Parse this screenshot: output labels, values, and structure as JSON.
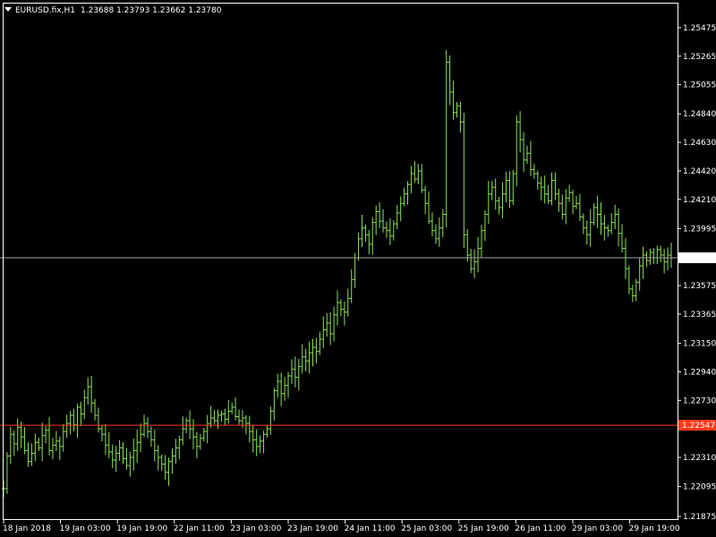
{
  "header": {
    "symbol": "EURUSD.fix,H1",
    "ohlc": "1.23688 1.23793 1.23662 1.23780"
  },
  "colors": {
    "background": "#000000",
    "bar": "#8be05a",
    "axis": "#ffffff",
    "bid_line": "#9fa6a8",
    "bid_label_bg": "#ffffff",
    "bid_label_text": "#000000",
    "alert_line": "#ff3b1a",
    "alert_label_bg": "#ff3b1a",
    "alert_label_text": "#000000"
  },
  "chart_data": {
    "type": "ohlc",
    "title": "",
    "ylim": [
      1.21875,
      1.2558
    ],
    "y_ticks": [
      "1.25475",
      "1.25265",
      "1.25055",
      "1.24840",
      "1.24630",
      "1.24420",
      "1.24210",
      "1.23995",
      "1.23780",
      "1.23575",
      "1.23365",
      "1.23150",
      "1.22940",
      "1.22730",
      "1.22547",
      "1.22310",
      "1.22095",
      "1.21875"
    ],
    "x_ticks": [
      "18 Jan 2018",
      "19 Jan 03:00",
      "19 Jan 19:00",
      "22 Jan 11:00",
      "23 Jan 03:00",
      "23 Jan 19:00",
      "24 Jan 11:00",
      "25 Jan 03:00",
      "25 Jan 19:00",
      "26 Jan 11:00",
      "29 Jan 03:00",
      "29 Jan 19:00"
    ],
    "current_price": "1.23780",
    "alert_level": "1.22547",
    "closes": [
      1.2208,
      1.2232,
      1.2248,
      1.2241,
      1.2253,
      1.2246,
      1.2236,
      1.2228,
      1.2234,
      1.2242,
      1.2238,
      1.2247,
      1.2251,
      1.2236,
      1.224,
      1.2243,
      1.2239,
      1.225,
      1.2256,
      1.2262,
      1.2255,
      1.2268,
      1.2263,
      1.2275,
      1.2283,
      1.2271,
      1.2262,
      1.2252,
      1.2248,
      1.224,
      1.2235,
      1.2229,
      1.2234,
      1.2238,
      1.223,
      1.2225,
      1.2231,
      1.2236,
      1.2242,
      1.2248,
      1.2256,
      1.225,
      1.2244,
      1.2236,
      1.2231,
      1.2226,
      1.222,
      1.2228,
      1.2232,
      1.2238,
      1.2244,
      1.2252,
      1.2258,
      1.2252,
      1.2246,
      1.2239,
      1.2245,
      1.225,
      1.2256,
      1.226,
      1.2258,
      1.2262,
      1.2263,
      1.2259,
      1.2265,
      1.2268,
      1.2261,
      1.2258,
      1.226,
      1.2256,
      1.225,
      1.2244,
      1.2239,
      1.2243,
      1.2248,
      1.2252,
      1.2265,
      1.228,
      1.2287,
      1.2278,
      1.2284,
      1.2291,
      1.2296,
      1.229,
      1.2298,
      1.2305,
      1.2302,
      1.2308,
      1.2312,
      1.2309,
      1.2318,
      1.2325,
      1.233,
      1.2322,
      1.2336,
      1.2345,
      1.234,
      1.2338,
      1.2348,
      1.2362,
      1.2378,
      1.2392,
      1.24,
      1.2395,
      1.2388,
      1.2404,
      1.2412,
      1.2405,
      1.24,
      1.2398,
      1.2394,
      1.2403,
      1.2411,
      1.2418,
      1.2425,
      1.2432,
      1.244,
      1.2436,
      1.2442,
      1.2428,
      1.2418,
      1.2405,
      1.2398,
      1.2392,
      1.24,
      1.241,
      1.2522,
      1.25,
      1.2485,
      1.249,
      1.2478,
      1.2395,
      1.238,
      1.237,
      1.2375,
      1.2385,
      1.2398,
      1.241,
      1.2425,
      1.243,
      1.242,
      1.2415,
      1.2425,
      1.2435,
      1.242,
      1.244,
      1.2478,
      1.2465,
      1.245,
      1.2455,
      1.2443,
      1.244,
      1.2433,
      1.243,
      1.2425,
      1.242,
      1.2435,
      1.2425,
      1.2418,
      1.241,
      1.2422,
      1.2426,
      1.2416,
      1.2418,
      1.2408,
      1.24,
      1.2395,
      1.2404,
      1.2415,
      1.241,
      1.2403,
      1.24,
      1.2398,
      1.2404,
      1.241,
      1.2396,
      1.2385,
      1.237,
      1.2355,
      1.235,
      1.236,
      1.2372,
      1.238,
      1.2376,
      1.2382,
      1.2378,
      1.2384,
      1.238,
      1.2375,
      1.238,
      1.2378
    ]
  }
}
